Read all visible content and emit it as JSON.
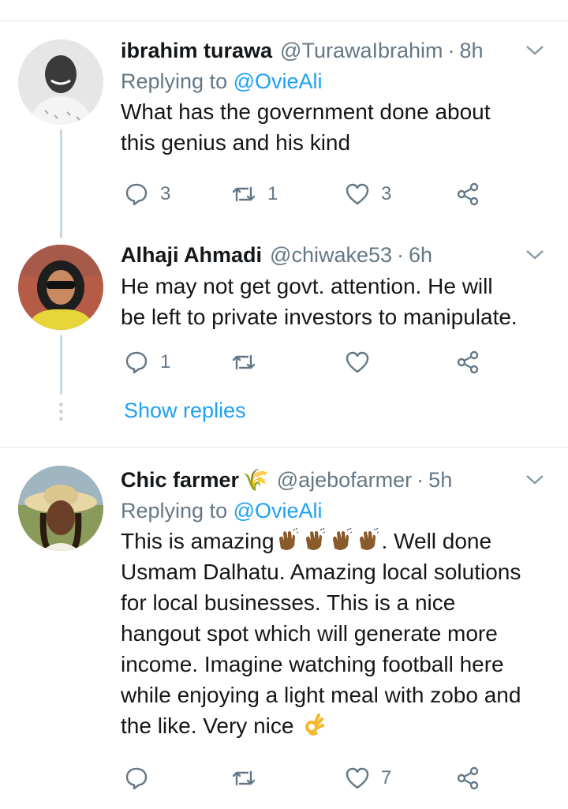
{
  "tweets": [
    {
      "name": "ibrahim turawa",
      "handle": "@TurawaIbrahim",
      "time": "8h",
      "replying_prefix": "Replying to",
      "replying_to": "@OvieAli",
      "text_lines": [
        "What has the government done about",
        "this genius and his kind"
      ],
      "counts": {
        "reply": "3",
        "retweet": "1",
        "like": "3"
      }
    },
    {
      "name": "Alhaji Ahmadi",
      "handle": "@chiwake53",
      "time": "6h",
      "text_lines": [
        "He may not get govt. attention. He will",
        "be left to private investors to manipulate."
      ],
      "counts": {
        "reply": "1",
        "retweet": "",
        "like": ""
      }
    },
    {
      "name": "Chic farmer",
      "name_suffix": "🌾",
      "handle": "@ajebofarmer",
      "time": "5h",
      "replying_prefix": "Replying to",
      "replying_to": "@OvieAli",
      "text_line1_start": "This is amazing",
      "text_line1_end": ". Well done",
      "text_lines_rest": [
        "Usmam Dalhatu. Amazing local solutions",
        "for local businesses. This is a nice",
        "hangout spot which will generate more",
        "income. Imagine watching football here",
        "while enjoying a light meal with zobo and"
      ],
      "text_last": "the like. Very nice",
      "counts": {
        "reply": "",
        "retweet": "",
        "like": "7"
      }
    }
  ],
  "show_replies": "Show replies",
  "icons": [
    "reply-icon",
    "retweet-icon",
    "like-icon",
    "share-icon",
    "chevron-down-icon",
    "clap-emoji",
    "ok-hand-emoji"
  ],
  "colors": {
    "link": "#1da1f2",
    "secondary": "#657786",
    "divider": "#e1e8ed"
  }
}
